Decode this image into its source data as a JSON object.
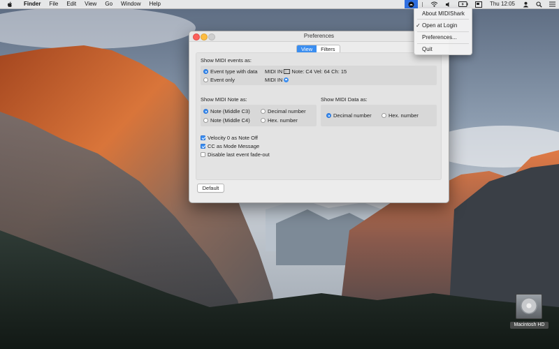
{
  "menubar": {
    "app_name": "Finder",
    "menus": [
      "File",
      "Edit",
      "View",
      "Go",
      "Window",
      "Help"
    ],
    "clock": "Thu 12:05",
    "status_icons": [
      "midishark-icon",
      "status-divider",
      "volume-icon",
      "wifi-icon",
      "battery-icon",
      "display-icon",
      "user-icon",
      "search-icon",
      "list-icon"
    ]
  },
  "dropdown": {
    "items": [
      {
        "label": "About MIDIShark",
        "checked": false
      },
      {
        "label": "Open at Login",
        "checked": true
      },
      {
        "label": "Preferences...",
        "checked": false
      },
      {
        "label": "Quit",
        "checked": false
      }
    ],
    "check_glyph": "✓"
  },
  "window": {
    "title": "Preferences",
    "tabs": [
      {
        "label": "View",
        "selected": true
      },
      {
        "label": "Filters",
        "selected": false
      }
    ],
    "events": {
      "title": "Show MIDI events as:",
      "options": [
        {
          "label": "Event type with data",
          "selected": true,
          "sample_prefix": "MIDI IN",
          "sample_suffix": "Note: C4 Vel: 64 Ch: 15"
        },
        {
          "label": "Event only",
          "selected": false,
          "sample_prefix": "MIDI IN"
        }
      ]
    },
    "note": {
      "title": "Show MIDI Note as:",
      "options": [
        {
          "label": "Note (Middle C3)",
          "selected": true
        },
        {
          "label": "Decimal number",
          "selected": false
        },
        {
          "label": "Note (Middle C4)",
          "selected": false
        },
        {
          "label": "Hex. number",
          "selected": false
        }
      ]
    },
    "data": {
      "title": "Show MIDI Data as:",
      "options": [
        {
          "label": "Decimal number",
          "selected": true
        },
        {
          "label": "Hex. number",
          "selected": false
        }
      ]
    },
    "checkboxes": [
      {
        "label": "Velocity 0 as Note Off",
        "checked": true
      },
      {
        "label": "CC as Mode Message",
        "checked": true
      },
      {
        "label": "Disable last event fade-out",
        "checked": false
      }
    ],
    "default_button": "Default"
  },
  "desktop": {
    "disk_label": "Macintosh HD"
  },
  "colors": {
    "accent": "#3b8ef0",
    "menu_highlight": "#2f6fe0"
  }
}
